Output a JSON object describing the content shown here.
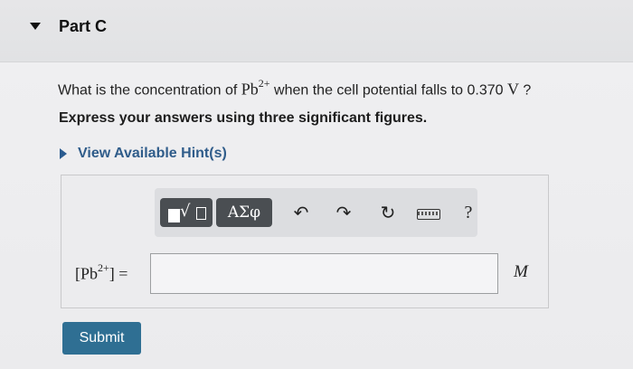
{
  "part": {
    "title": "Part C"
  },
  "question": {
    "prefix": "What is the concentration of ",
    "species": "Pb",
    "charge": "2+",
    "middle": " when the cell potential falls to ",
    "value": "0.370",
    "unit": "V",
    "suffix": " ?"
  },
  "instruction": "Express your answers using three significant figures.",
  "hint": {
    "label": "View Available Hint(s)"
  },
  "toolbar": {
    "greek_label": "ΑΣφ",
    "help_label": "?",
    "icons": [
      "templates-icon",
      "greek-symbols-icon",
      "undo-icon",
      "redo-icon",
      "reset-icon",
      "keyboard-icon",
      "help-icon"
    ]
  },
  "answer": {
    "label_open": "[",
    "label_species": "Pb",
    "label_charge": "2+",
    "label_close": "] =",
    "value": "",
    "unit": "M"
  },
  "submit": {
    "label": "Submit"
  }
}
